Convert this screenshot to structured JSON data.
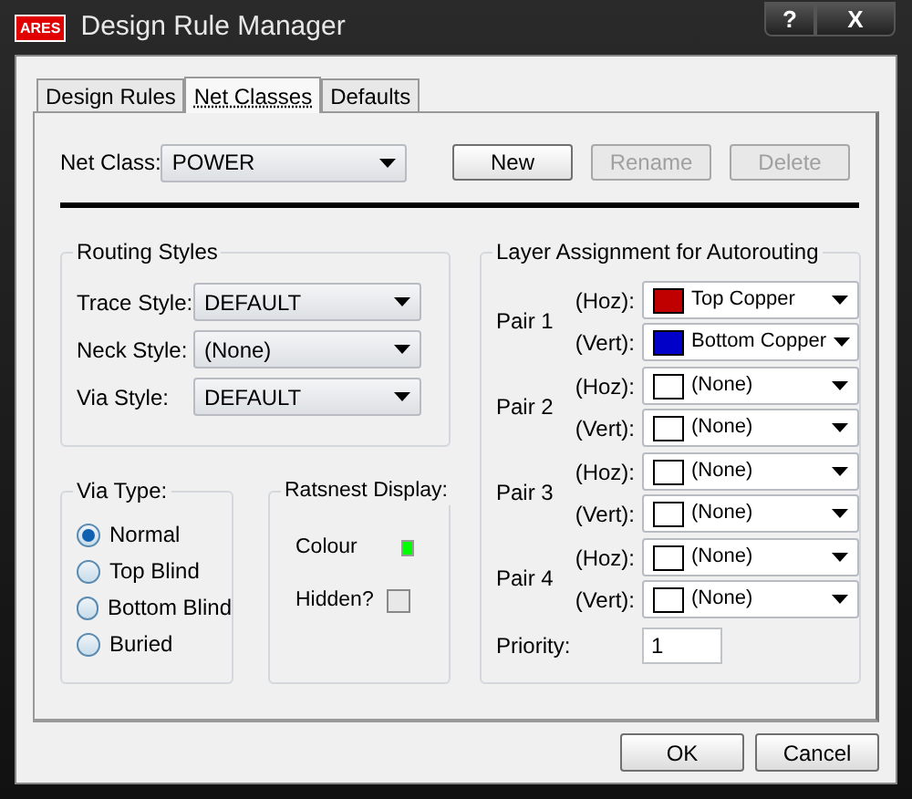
{
  "window": {
    "logo": "ARES",
    "title": "Design Rule Manager",
    "help": "?",
    "close": "X"
  },
  "tabs": [
    {
      "label": "Design Rules",
      "selected": false
    },
    {
      "label": "Net Classes",
      "selected": true
    },
    {
      "label": "Defaults",
      "selected": false
    }
  ],
  "net_class": {
    "label": "Net Class:",
    "value": "POWER"
  },
  "class_buttons": [
    {
      "label": "New",
      "disabled": false
    },
    {
      "label": "Rename",
      "disabled": true
    },
    {
      "label": "Delete",
      "disabled": true
    }
  ],
  "routing_styles": {
    "title": "Routing Styles",
    "rows": [
      {
        "label": "Trace Style:",
        "value": "DEFAULT"
      },
      {
        "label": "Neck Style:",
        "value": "(None)"
      },
      {
        "label": "Via Style:",
        "value": "DEFAULT"
      }
    ]
  },
  "via_type": {
    "title": "Via Type:",
    "options": [
      {
        "label": "Normal",
        "selected": true
      },
      {
        "label": "Top Blind",
        "selected": false
      },
      {
        "label": "Bottom Blind",
        "selected": false
      },
      {
        "label": "Buried",
        "selected": false
      }
    ]
  },
  "ratsnest": {
    "title": "Ratsnest Display:",
    "colour_label": "Colour",
    "color": "#00ff00",
    "hidden_label": "Hidden?",
    "hidden": false
  },
  "layers": {
    "title": "Layer Assignment for Autorouting",
    "pairs": [
      {
        "label": "Pair 1",
        "layers": [
          {
            "axis": "(Hoz):",
            "value": "Top Copper",
            "color": "#c00000"
          },
          {
            "axis": "(Vert):",
            "value": "Bottom Copper",
            "color": "#0000c8"
          }
        ]
      },
      {
        "label": "Pair 2",
        "layers": [
          {
            "axis": "(Hoz):",
            "value": "(None)",
            "color": "#ffffff"
          },
          {
            "axis": "(Vert):",
            "value": "(None)",
            "color": "#ffffff"
          }
        ]
      },
      {
        "label": "Pair 3",
        "layers": [
          {
            "axis": "(Hoz):",
            "value": "(None)",
            "color": "#ffffff"
          },
          {
            "axis": "(Vert):",
            "value": "(None)",
            "color": "#ffffff"
          }
        ]
      },
      {
        "label": "Pair 4",
        "layers": [
          {
            "axis": "(Hoz):",
            "value": "(None)",
            "color": "#ffffff"
          },
          {
            "axis": "(Vert):",
            "value": "(None)",
            "color": "#ffffff"
          }
        ]
      }
    ],
    "priority": {
      "label": "Priority:",
      "value": "1"
    }
  },
  "footer_buttons": [
    {
      "label": "OK"
    },
    {
      "label": "Cancel"
    }
  ]
}
